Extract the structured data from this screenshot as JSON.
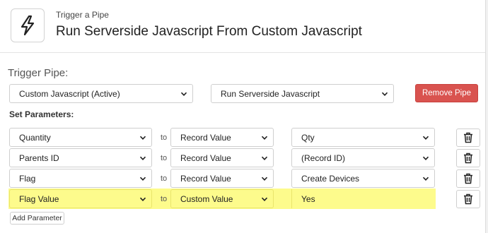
{
  "header": {
    "subtitle": "Trigger a Pipe",
    "title": "Run Serverside Javascript From Custom Javascript"
  },
  "trigger": {
    "label": "Trigger Pipe:",
    "source_select": "Custom Javascript (Active)",
    "action_select": "Run Serverside Javascript",
    "remove_button": "Remove Pipe"
  },
  "params": {
    "label": "Set Parameters:",
    "to_word": "to",
    "rows": [
      {
        "field": "Quantity",
        "type": "Record Value",
        "value": "Qty",
        "highlighted": false
      },
      {
        "field": "Parents ID",
        "type": "Record Value",
        "value": "(Record ID)",
        "highlighted": false
      },
      {
        "field": "Flag",
        "type": "Record Value",
        "value": "Create Devices",
        "highlighted": false
      },
      {
        "field": "Flag Value",
        "type": "Custom Value",
        "value": "Yes",
        "highlighted": true
      }
    ],
    "add_button": "Add Parameter"
  },
  "colors": {
    "remove_button": "#d9534f",
    "highlight": "#fdfb8c"
  },
  "icons": {
    "header": "lightning-bolt-icon",
    "row_action": "trash-icon",
    "dropdown": "chevron-down-icon"
  }
}
